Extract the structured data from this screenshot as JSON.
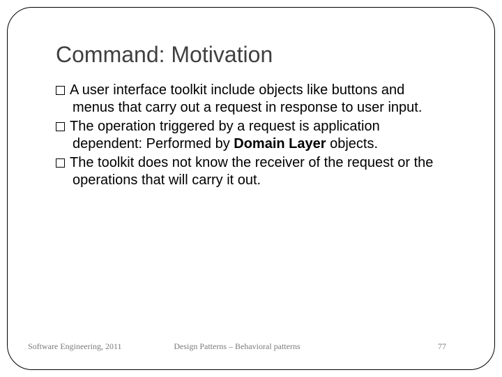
{
  "slide": {
    "title": "Command: Motivation",
    "bullets": [
      {
        "text_before": "A user interface toolkit include objects like buttons and menus that carry out a request in response to user input.",
        "bold_text": "",
        "text_after": ""
      },
      {
        "text_before": "The operation triggered by a request is application dependent: Performed by ",
        "bold_text": "Domain Layer",
        "text_after": " objects."
      },
      {
        "text_before": "The toolkit does not know the receiver of the request or the operations that will carry it out.",
        "bold_text": "",
        "text_after": ""
      }
    ],
    "footer": {
      "left": "Software Engineering, 2011",
      "center": "Design Patterns – Behavioral patterns",
      "right": "77"
    }
  }
}
